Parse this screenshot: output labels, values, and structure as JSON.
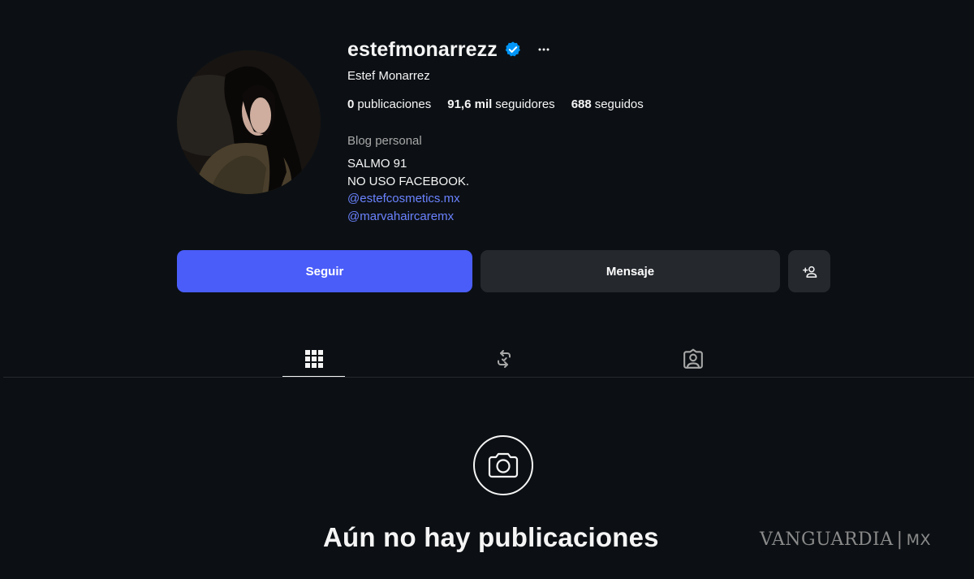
{
  "profile": {
    "username": "estefmonarrezz",
    "full_name": "Estef Monarrez",
    "verified": true,
    "more_icon": "ellipsis-icon",
    "avatar_icon": "profile-photo",
    "stats": {
      "posts_count": "0",
      "posts_label": "publicaciones",
      "followers_count": "91,6 mil",
      "followers_label": "seguidores",
      "following_count": "688",
      "following_label": "seguidos"
    },
    "category": "Blog personal",
    "bio_lines": [
      "SALMO 91",
      "NO USO FACEBOOK."
    ],
    "bio_links": [
      "@estefcosmetics.mx",
      "@marvahaircaremx"
    ]
  },
  "actions": {
    "follow_label": "Seguir",
    "message_label": "Mensaje",
    "suggest_icon": "add-person-icon"
  },
  "tabs": [
    {
      "name": "posts",
      "icon": "grid-icon",
      "selected": true
    },
    {
      "name": "reposts",
      "icon": "repost-icon",
      "selected": false
    },
    {
      "name": "tagged",
      "icon": "tagged-person-icon",
      "selected": false
    }
  ],
  "empty_state": {
    "icon": "camera-icon",
    "title": "Aún no hay publicaciones"
  },
  "watermark": {
    "brand": "VANGUARDIA",
    "separator": "|",
    "region": "MX"
  },
  "colors": {
    "background": "#0c1014",
    "accent": "#4a5df9",
    "link": "#6b82ff",
    "verified_badge": "#0095f6",
    "secondary_button": "#25292e"
  }
}
